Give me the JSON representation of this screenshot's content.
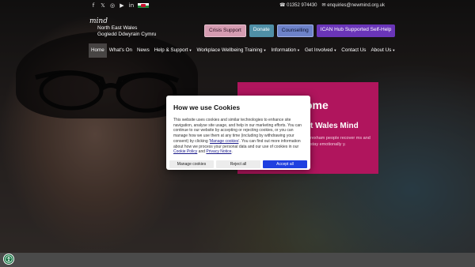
{
  "topbar": {
    "social_icons": [
      "facebook-icon",
      "x-icon",
      "instagram-icon",
      "youtube-icon",
      "welsh-flag-icon"
    ],
    "phone": "01352 974430",
    "email": "enquiries@newmind.org.uk"
  },
  "logo": {
    "brand": "mind",
    "line1": "North East Wales",
    "line2": "Gogledd Ddwyrain Cymru"
  },
  "header_buttons": {
    "crisis": "Crisis Support",
    "donate": "Donate",
    "counselling": "Counselling",
    "ican": "ICAN Hub Supported Self-Help"
  },
  "nav": {
    "items": [
      {
        "label": "Home",
        "active": true,
        "dropdown": false
      },
      {
        "label": "What's On",
        "active": false,
        "dropdown": false
      },
      {
        "label": "News",
        "active": false,
        "dropdown": false
      },
      {
        "label": "Help & Support",
        "active": false,
        "dropdown": true
      },
      {
        "label": "Workplace Wellbeing Training",
        "active": false,
        "dropdown": true
      },
      {
        "label": "Information",
        "active": false,
        "dropdown": true
      },
      {
        "label": "Get Involved",
        "active": false,
        "dropdown": true
      },
      {
        "label": "Contact Us",
        "active": false,
        "dropdown": false
      },
      {
        "label": "About Us",
        "active": false,
        "dropdown": true
      }
    ]
  },
  "welcome": {
    "heading": "ome",
    "subheading": "t Wales Mind",
    "text": "rexham people recover ms and stay emotionally y."
  },
  "cookie": {
    "title": "How we use Cookies",
    "text_before_manage": "This website uses cookies and similar technologies to enhance site navigation, analyse site usage, and help in our marketing efforts. You can continue to our website by accepting or rejecting cookies, or you can manage how we use them at any time (including by withdrawing your consent) by clicking '",
    "manage_link": "Manage cookies",
    "text_before_policy": "'. You can find out more information about how we process your personal data and our use of cookies in our ",
    "cookie_policy_link": "Cookie Policy",
    "and": " and ",
    "privacy_link": "Privacy Notice",
    "end": ".",
    "manage_button": "Manage cookies",
    "reject_button": "Reject all",
    "accept_button": "Accept all"
  },
  "colors": {
    "panel_magenta": "#b0155d",
    "accept_blue": "#1f3fe0",
    "accessibility_green": "#0d6e3c"
  },
  "accessibility": {
    "icon": "accessibility-icon"
  }
}
